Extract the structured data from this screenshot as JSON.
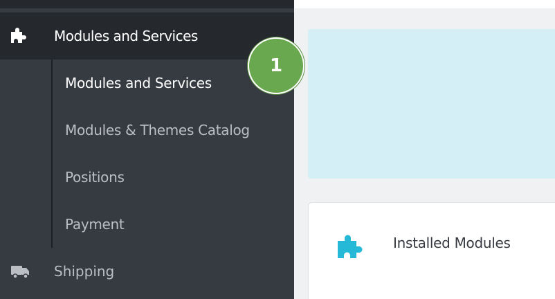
{
  "sidebar": {
    "active_section": {
      "label": "Modules and Services",
      "icon": "puzzle-icon"
    },
    "submenu": [
      {
        "label": "Modules and Services",
        "active": true
      },
      {
        "label": "Modules & Themes Catalog",
        "active": false
      },
      {
        "label": "Positions",
        "active": false
      },
      {
        "label": "Payment",
        "active": false
      }
    ],
    "next_section": {
      "label": "Shipping",
      "icon": "truck-icon"
    }
  },
  "main": {
    "card": {
      "label": "Installed Modules",
      "icon": "puzzle-icon"
    }
  },
  "step_badge": {
    "number": "1"
  },
  "colors": {
    "sidebar_bg": "#363a41",
    "sidebar_active_bg": "#25282c",
    "alert_bg": "#d4f0f6",
    "badge_bg": "#6aa84f",
    "accent_blue": "#25b9d7"
  }
}
